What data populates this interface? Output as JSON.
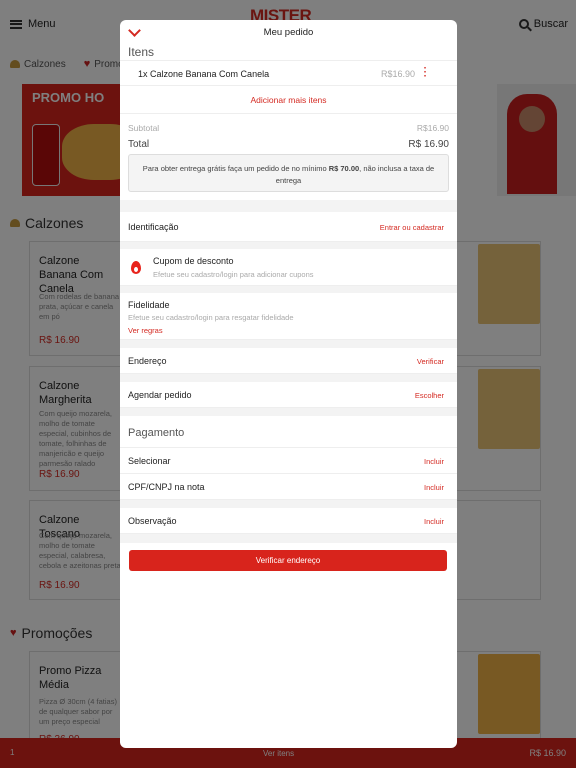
{
  "background": {
    "menu_label": "Menu",
    "logo_text": "MISTER",
    "search_label": "Buscar",
    "tabs": [
      {
        "label": "Calzones",
        "icon": "calzone-icon"
      },
      {
        "label": "Promo",
        "icon": "heart-icon"
      }
    ],
    "banner_left_text": "PROMO HO",
    "sections": {
      "calzones": "Calzones",
      "promocoes": "Promoções"
    },
    "cards": [
      {
        "title": "Calzone Banana Com Canela",
        "desc": "Com rodelas de banana prata, açúcar e canela em pó",
        "price": "R$ 16.90"
      },
      {
        "title": "Calzone Margherita",
        "desc": "Com queijo mozarela, molho de tomate especial, cubinhos de tomate, folhinhas de manjericão e queijo parmesão ralado",
        "price": "R$ 16.90"
      },
      {
        "title": "Calzone Toscano",
        "desc": "Com queijo mozarela, molho de tomate especial, calabresa, cebola e azeitonas preta",
        "price": "R$ 16.90"
      },
      {
        "title": "Promo Pizza Média",
        "desc": "Pizza Ø 30cm (4 fatias) de qualquer sabor por um preço especial",
        "price": "R$ 36.90"
      }
    ],
    "bottom_bar": {
      "qty": "1",
      "label": "Ver itens",
      "total": "R$ 16.90"
    }
  },
  "modal": {
    "title": "Meu pedido",
    "items_header": "Itens",
    "items": [
      {
        "name": "1x Calzone Banana Com Canela",
        "price": "R$16.90"
      }
    ],
    "add_more": "Adicionar mais itens",
    "subtotal_label": "Subtotal",
    "subtotal_value": "R$16.90",
    "total_label": "Total",
    "total_value": "R$ 16.90",
    "notice_prefix": "Para obter entrega grátis faça um pedido de no mínimo ",
    "notice_amount": "R$ 70.00",
    "notice_suffix": ", não inclusa a taxa de entrega",
    "identificacao": {
      "label": "Identificação",
      "action": "Entrar ou cadastrar"
    },
    "cupom": {
      "label": "Cupom de desconto",
      "sub": "Efetue seu cadastro/login para adicionar cupons"
    },
    "fidelidade": {
      "label": "Fidelidade",
      "sub": "Efetue seu cadastro/login para resgatar fidelidade",
      "link": "Ver regras"
    },
    "endereco": {
      "label": "Endereço",
      "action": "Verificar"
    },
    "agendar": {
      "label": "Agendar pedido",
      "action": "Escolher"
    },
    "pagamento_header": "Pagamento",
    "selecionar": {
      "label": "Selecionar",
      "action": "Incluir"
    },
    "cpf": {
      "label": "CPF/CNPJ na nota",
      "action": "Incluir"
    },
    "observacao": {
      "label": "Observação",
      "action": "Incluir"
    },
    "verify_button": "Verificar endereço"
  },
  "colors": {
    "accent": "#d8241c",
    "overlay": "rgba(0,0,0,0.5)"
  }
}
